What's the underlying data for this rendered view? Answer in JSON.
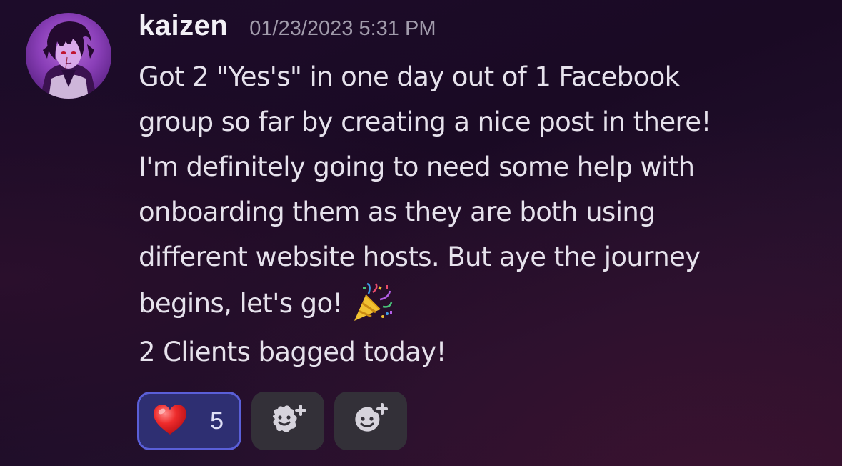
{
  "message": {
    "username": "kaizen",
    "timestamp": "01/23/2023 5:31 PM",
    "lines": [
      "Got 2 \"Yes's\" in one day out of 1 Facebook",
      "group so far by creating a nice post in there!",
      "I'm definitely going to need some help with",
      "onboarding them as they are both using",
      "different website hosts. But aye the journey",
      "begins, let's go!",
      "2 Clients bagged today!"
    ],
    "inline_emoji": "party-popper-icon"
  },
  "reactions": [
    {
      "emoji": "heart-icon",
      "count": "5",
      "selected": true
    },
    {
      "emoji": "add-super-reaction-icon"
    },
    {
      "emoji": "add-reaction-icon"
    }
  ],
  "colors": {
    "username": "#f2f0f6",
    "timestamp": "#a19bab",
    "text": "#e6e2ec",
    "reaction_selected_bg": "#2e2f72",
    "reaction_selected_border": "#5a5fd8",
    "reaction_bg": "#333038"
  }
}
